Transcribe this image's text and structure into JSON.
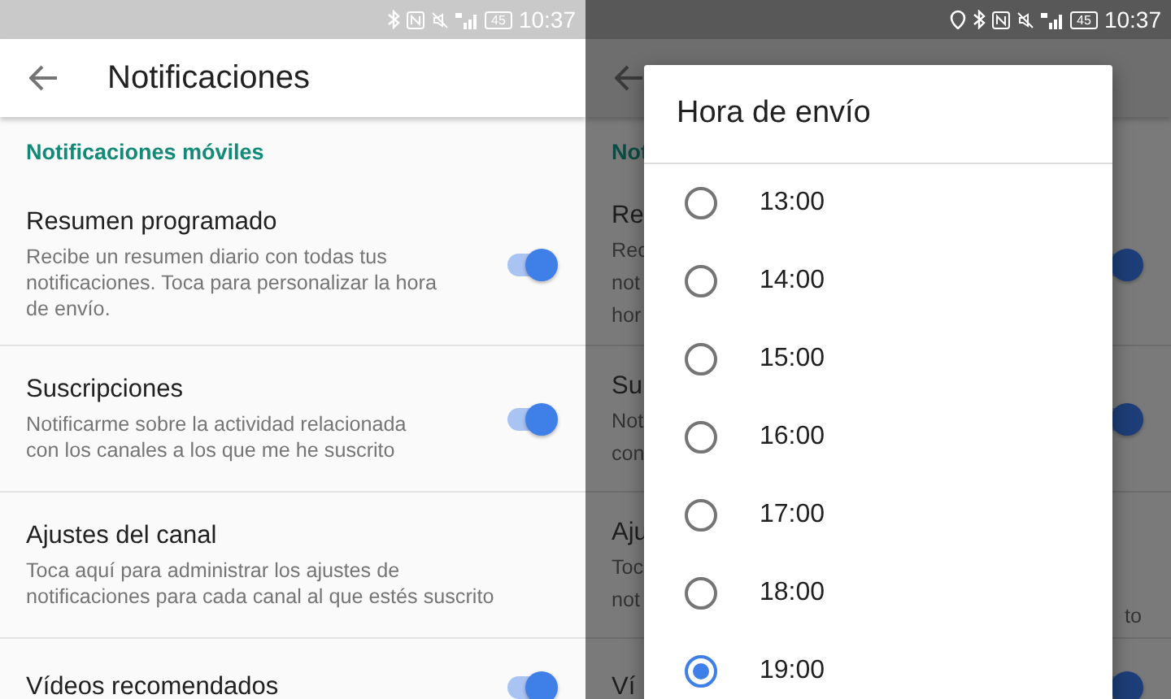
{
  "screen": {
    "status_bar": {
      "location": false,
      "battery": "45",
      "time": "10:37"
    },
    "app_bar": {
      "title": "Notificaciones"
    },
    "section": "Notificaciones móviles",
    "items": [
      {
        "kind": "toggle",
        "title": "Resumen programado",
        "description": "Recibe un resumen diario con todas tus notificaciones. Toca para personalizar la hora de envío.",
        "on": true
      },
      {
        "kind": "toggle",
        "title": "Suscripciones",
        "description": "Notificarme sobre la actividad relacionada con los canales a los que me he suscrito",
        "on": true
      },
      {
        "kind": "link",
        "title": "Ajustes del canal",
        "description": "Toca aquí para administrar los ajustes de notificaciones para cada canal al que estés suscrito"
      },
      {
        "kind": "toggle",
        "title": "Vídeos recomendados",
        "on": true
      }
    ]
  },
  "dimmed_screen": {
    "status_bar": {
      "location": true,
      "battery": "45",
      "time": "10:37"
    },
    "section": "Not",
    "items": [
      {
        "kind": "toggle",
        "title": "Re",
        "description_lines": [
          "Rec",
          "not",
          "hor"
        ],
        "on": true
      },
      {
        "kind": "toggle",
        "title": "Su",
        "description_lines": [
          "Not",
          "con"
        ],
        "on": true
      },
      {
        "kind": "link",
        "title": "Aju",
        "description_lines": [
          "Toc",
          "not"
        ],
        "trailing": "to"
      },
      {
        "kind": "toggle",
        "title": "Ví",
        "on": true
      }
    ]
  },
  "dialog": {
    "title": "Hora de envío",
    "options": [
      {
        "label": "13:00",
        "selected": false
      },
      {
        "label": "14:00",
        "selected": false
      },
      {
        "label": "15:00",
        "selected": false
      },
      {
        "label": "16:00",
        "selected": false
      },
      {
        "label": "17:00",
        "selected": false
      },
      {
        "label": "18:00",
        "selected": false
      },
      {
        "label": "19:00",
        "selected": true
      }
    ]
  }
}
